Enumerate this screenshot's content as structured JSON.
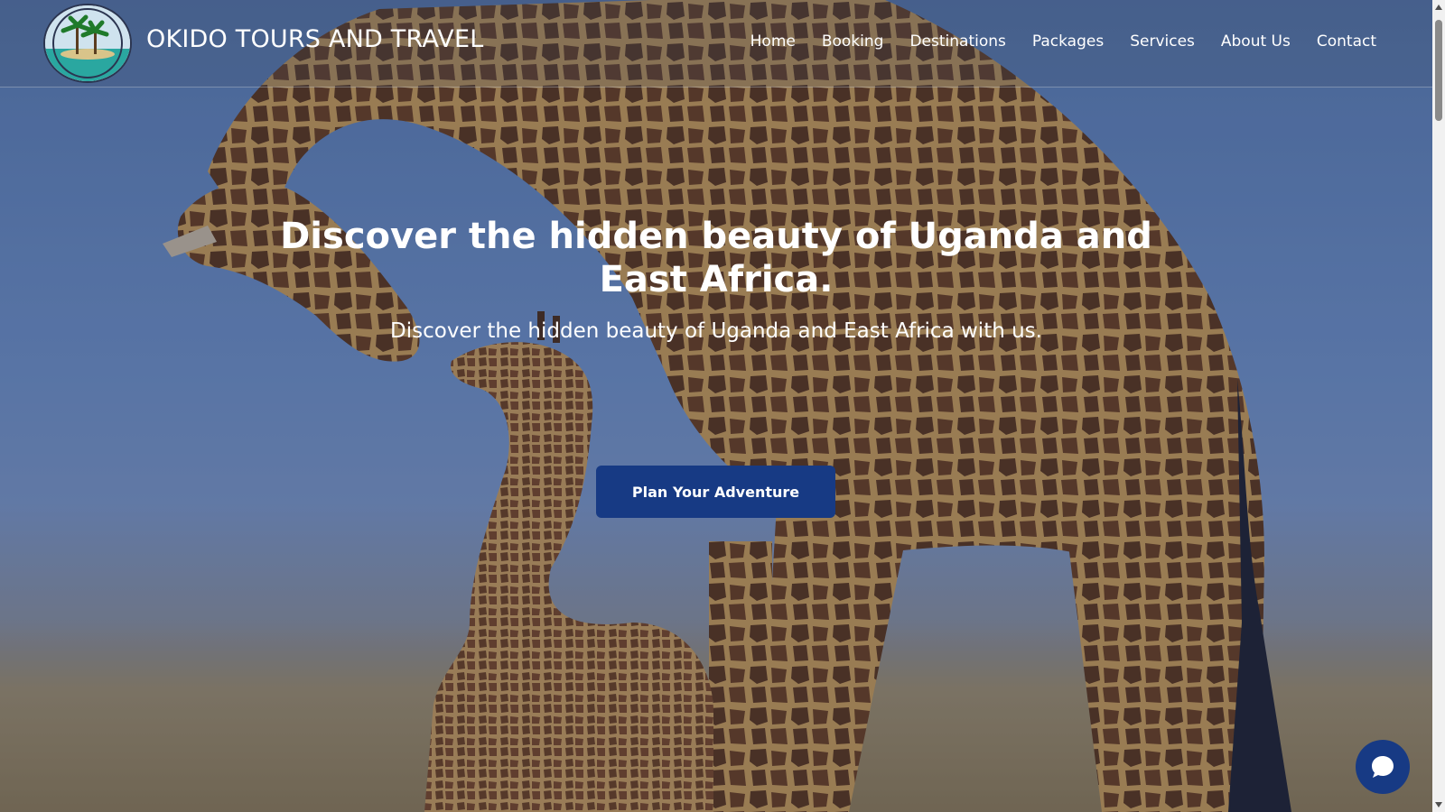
{
  "header": {
    "brand_name": "OKIDO TOURS AND TRAVEL",
    "nav": [
      {
        "label": "Home"
      },
      {
        "label": "Booking"
      },
      {
        "label": "Destinations"
      },
      {
        "label": "Packages"
      },
      {
        "label": "Services"
      },
      {
        "label": "About Us"
      },
      {
        "label": "Contact"
      }
    ]
  },
  "hero": {
    "title": "Discover the hidden beauty of Uganda and East Africa.",
    "subtitle": "Discover the hidden beauty of Uganda and East Africa with us.",
    "cta_label": "Plan Your Adventure"
  },
  "chat": {
    "icon": "chat-bubble-icon"
  },
  "colors": {
    "primary": "#173a84",
    "text": "#ffffff",
    "scrollbar_track": "#f1f1f1",
    "scrollbar_thumb": "#8a8a8a"
  }
}
